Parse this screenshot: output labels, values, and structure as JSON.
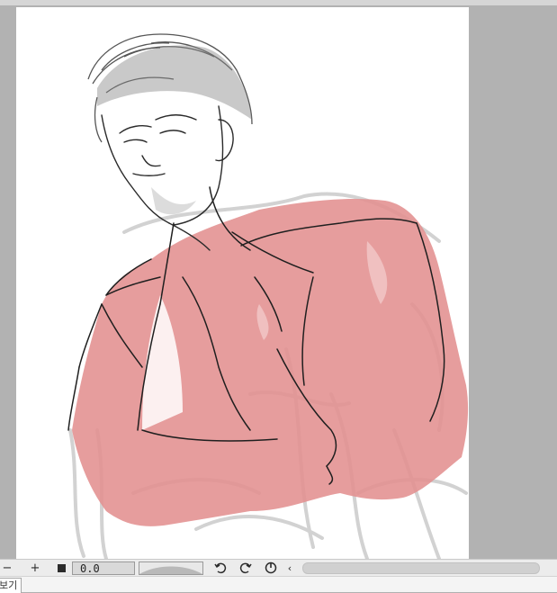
{
  "statusbar": {
    "zoom_out_icon": "minus-icon",
    "zoom_in_icon": "plus-icon",
    "fit_icon": "square-icon",
    "rotation_value": "0.0",
    "undo_icon": "rotate-left-icon",
    "redo_icon": "rotate-right-icon",
    "reset_icon": "reset-rotation-icon",
    "scroll_left_icon": "chevron-left-icon"
  },
  "tabbar": {
    "tabs": [
      {
        "label": "보기"
      }
    ]
  },
  "colors": {
    "workspace": "#b2b2b2",
    "paper": "#ffffff",
    "shirt_fill": "#e28f8f",
    "line_art": "#2a2a2a",
    "sketch_gray": "#cfcfcf"
  }
}
